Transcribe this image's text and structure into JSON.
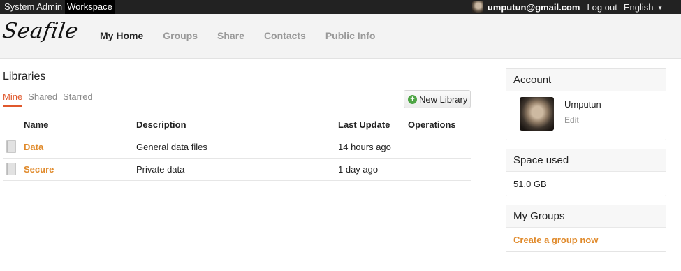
{
  "topbar": {
    "system_admin": "System Admin",
    "workspace": "Workspace",
    "user_email": "umputun@gmail.com",
    "logout": "Log out",
    "language": "English",
    "language_caret": "▼"
  },
  "header": {
    "logo": "Seafile",
    "nav": [
      "My Home",
      "Groups",
      "Share",
      "Contacts",
      "Public Info"
    ]
  },
  "main": {
    "title": "Libraries",
    "tabs": [
      "Mine",
      "Shared",
      "Starred"
    ],
    "new_library_label": "New Library",
    "new_library_icon": "+",
    "columns": [
      "Name",
      "Description",
      "Last Update",
      "Operations"
    ],
    "rows": [
      {
        "name": "Data",
        "description": "General data files",
        "last_update": "14 hours ago"
      },
      {
        "name": "Secure",
        "description": "Private data",
        "last_update": "1 day ago"
      }
    ]
  },
  "sidebar": {
    "account": {
      "title": "Account",
      "name": "Umputun",
      "edit": "Edit"
    },
    "space": {
      "title": "Space used",
      "value": "51.0 GB"
    },
    "groups": {
      "title": "My Groups",
      "create_link": "Create a group now"
    }
  },
  "colors": {
    "accent_orange": "#e08a2b",
    "active_tab_red": "#e0582c",
    "topbar_bg": "#222222",
    "add_icon_green": "#4ea545"
  },
  "icons": [
    "user-avatar-icon",
    "caret-down-icon",
    "plus-circle-icon",
    "library-icon"
  ]
}
